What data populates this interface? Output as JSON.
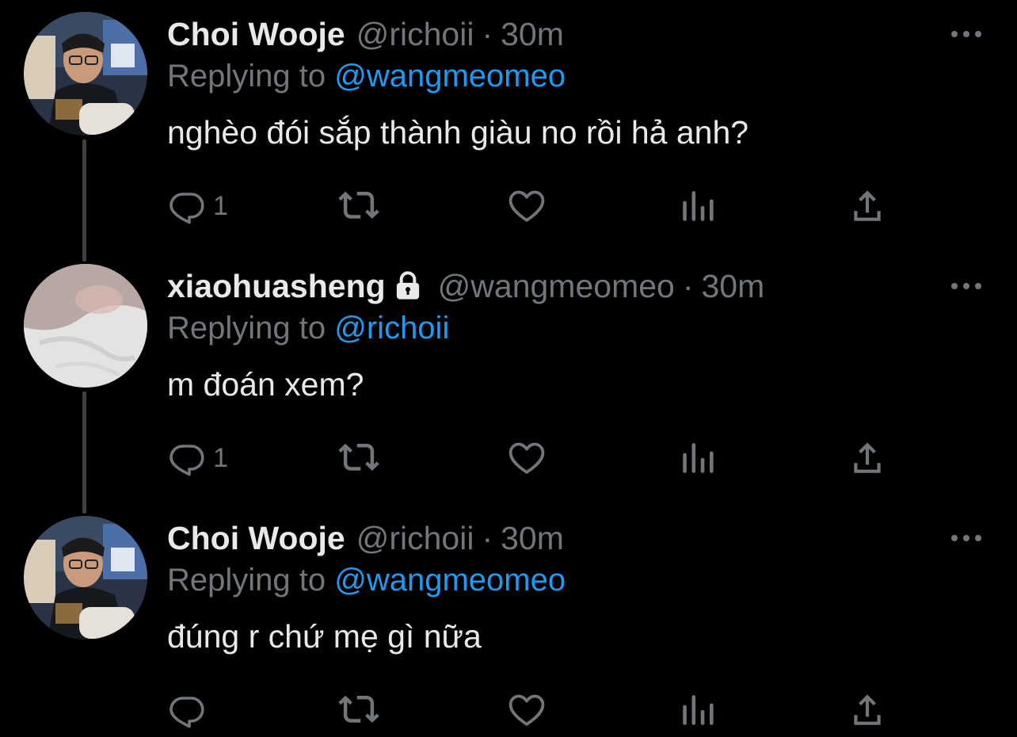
{
  "tweets": [
    {
      "name": "Choi Wooje",
      "handle": "@richoii",
      "separator": "·",
      "time": "30m",
      "replying_prefix": "Replying to",
      "replying_to": "@wangmeomeo",
      "text": "nghèo đói sắp thành giàu no rồi hả anh?",
      "reply_count": "1",
      "locked": false,
      "avatar": "photo-man-glasses"
    },
    {
      "name": "xiaohuasheng",
      "handle": "@wangmeomeo",
      "separator": "·",
      "time": "30m",
      "replying_prefix": "Replying to",
      "replying_to": "@richoii",
      "text": "m đoán xem?",
      "reply_count": "1",
      "locked": true,
      "avatar": "photo-white-fabric"
    },
    {
      "name": "Choi Wooje",
      "handle": "@richoii",
      "separator": "·",
      "time": "30m",
      "replying_prefix": "Replying to",
      "replying_to": "@wangmeomeo",
      "text": "đúng r chứ mẹ gì nữa",
      "reply_count": "",
      "locked": false,
      "avatar": "photo-man-glasses"
    }
  ],
  "icons": {
    "reply": "reply-icon",
    "retweet": "retweet-icon",
    "like": "heart-icon",
    "views": "analytics-icon",
    "share": "share-icon",
    "more": "more-icon",
    "lock": "lock-icon"
  },
  "colors": {
    "background": "#000000",
    "text": "#e7e9ea",
    "secondary": "#71767b",
    "link": "#1d9bf0",
    "thread_line": "#3e4144"
  }
}
